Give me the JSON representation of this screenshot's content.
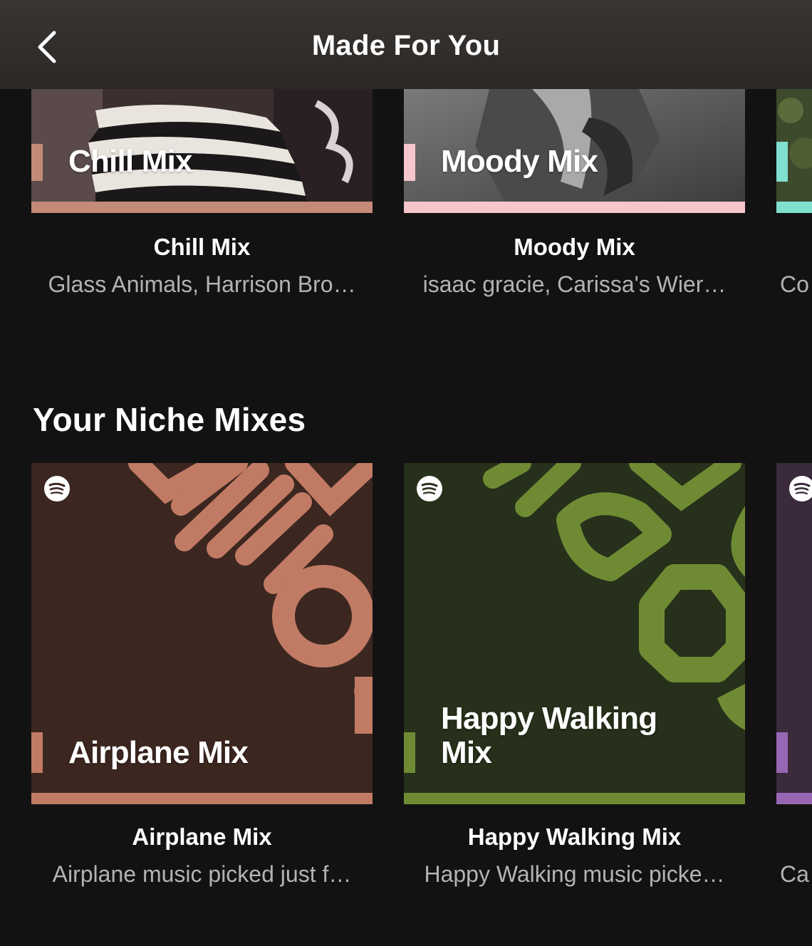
{
  "header": {
    "title": "Made For You"
  },
  "top_row": {
    "cards": [
      {
        "art_label": "Chill Mix",
        "title": "Chill Mix",
        "subtitle": "Glass Animals, Harrison Bro…",
        "accent": "#c48a78"
      },
      {
        "art_label": "Moody Mix",
        "title": "Moody Mix",
        "subtitle": "isaac gracie, Carissa's Wier…",
        "accent": "#f5c6cb"
      }
    ],
    "peek": {
      "subtitle": "Co",
      "accent": "#7fe0cf"
    }
  },
  "niche": {
    "title": "Your Niche Mixes",
    "cards": [
      {
        "art_label": "Airplane Mix",
        "title": "Airplane Mix",
        "subtitle": "Airplane music picked just f…",
        "accent": "#c17b64",
        "bg": "#3c2620"
      },
      {
        "art_label_line1": "Happy Walking",
        "art_label_line2": "Mix",
        "title": "Happy Walking Mix",
        "subtitle": "Happy Walking music picke…",
        "accent": "#6e8b34",
        "bg": "#27301a"
      }
    ],
    "peek": {
      "subtitle": "Ca",
      "accent": "#9867b4",
      "bg": "#3a2a3c"
    }
  }
}
